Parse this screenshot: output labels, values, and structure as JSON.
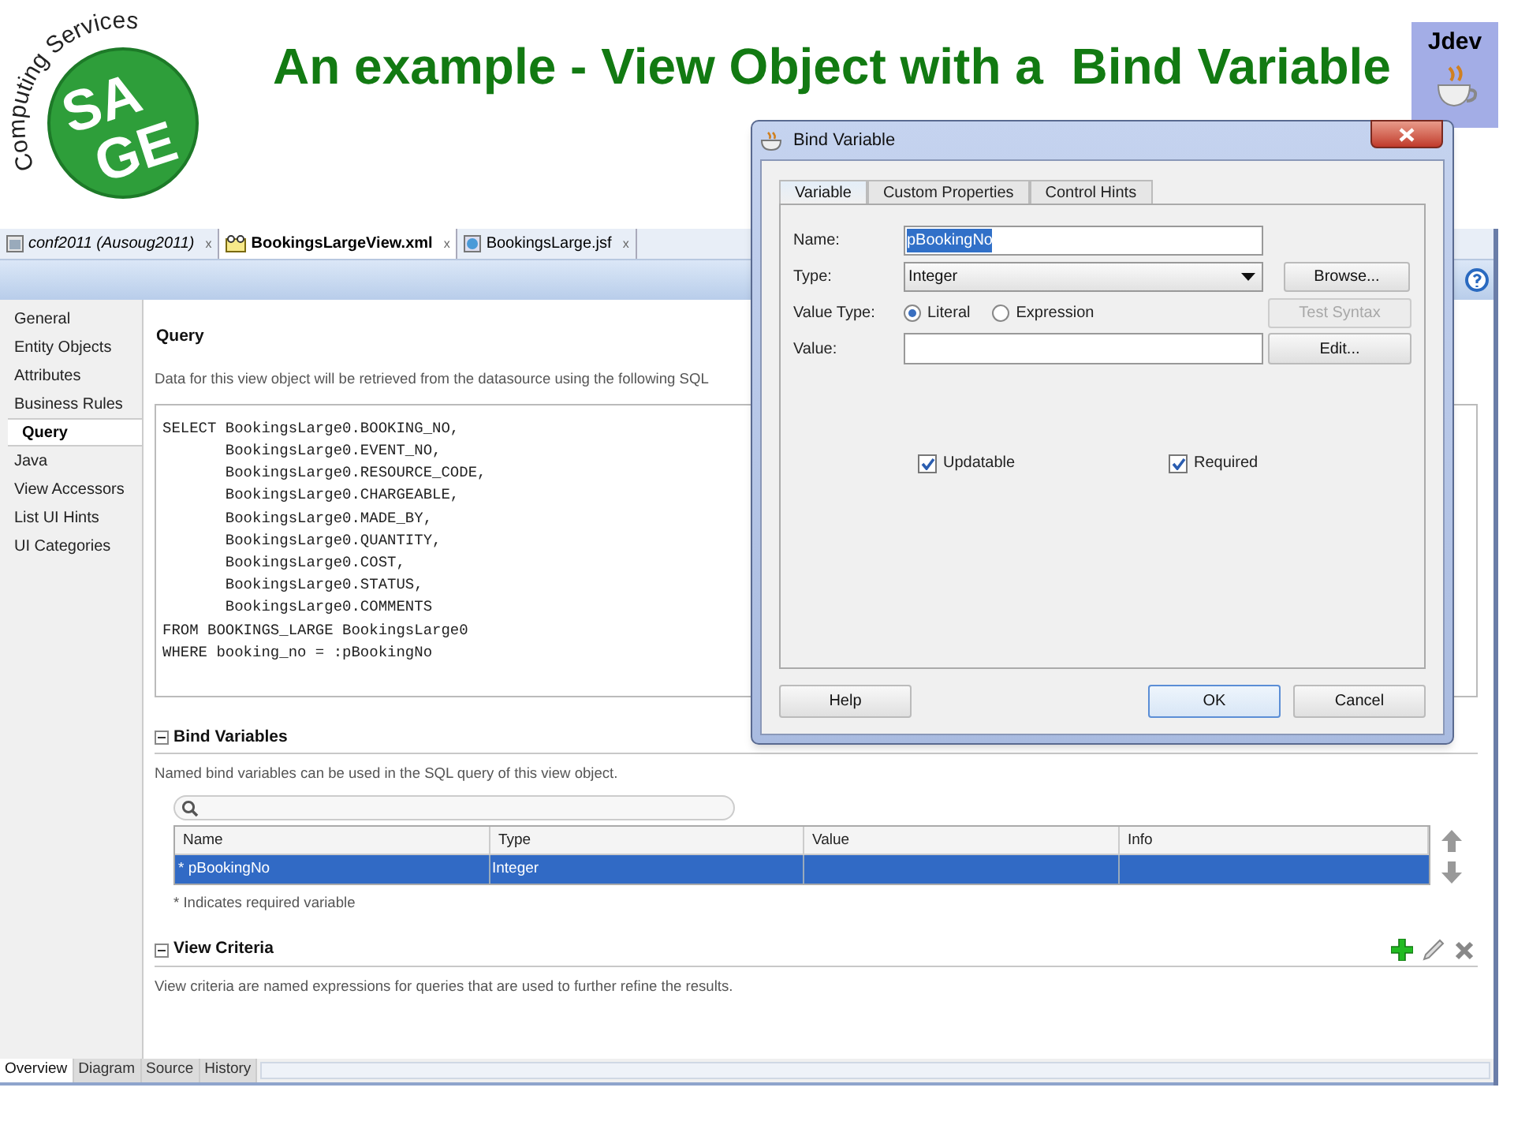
{
  "slide": {
    "title": "An example - View Object with a  Bind Variable",
    "logo": {
      "arc_text": "Computing Services",
      "line_1": "SA",
      "line_2": "GE"
    },
    "badge": "Jdev"
  },
  "editor_tabs": [
    {
      "label": "conf2011 (Ausoug2011)",
      "kind": "project",
      "selected": false,
      "close": "x"
    },
    {
      "label": "BookingsLargeView.xml",
      "kind": "xml",
      "selected": true,
      "close": "x"
    },
    {
      "label": "BookingsLarge.jsf",
      "kind": "jsf",
      "selected": false,
      "close": "x"
    }
  ],
  "sidebar": {
    "items": [
      {
        "label": "General",
        "selected": false
      },
      {
        "label": "Entity Objects",
        "selected": false
      },
      {
        "label": "Attributes",
        "selected": false
      },
      {
        "label": "Business Rules",
        "selected": false
      },
      {
        "label": "Query",
        "selected": true
      },
      {
        "label": "Java",
        "selected": false
      },
      {
        "label": "View Accessors",
        "selected": false
      },
      {
        "label": "List UI Hints",
        "selected": false
      },
      {
        "label": "UI Categories",
        "selected": false
      }
    ]
  },
  "query": {
    "heading": "Query",
    "description": "Data for this view object will be retrieved from the datasource using the following SQL",
    "sql": [
      "SELECT BookingsLarge0.BOOKING_NO,",
      "       BookingsLarge0.EVENT_NO,",
      "       BookingsLarge0.RESOURCE_CODE,",
      "       BookingsLarge0.CHARGEABLE,",
      "       BookingsLarge0.MADE_BY,",
      "       BookingsLarge0.QUANTITY,",
      "       BookingsLarge0.COST,",
      "       BookingsLarge0.STATUS,",
      "       BookingsLarge0.COMMENTS",
      "FROM BOOKINGS_LARGE BookingsLarge0",
      "WHERE booking_no = :pBookingNo"
    ]
  },
  "bind_variables": {
    "heading": "Bind Variables",
    "expanded": true,
    "description": "Named bind variables can be used in the SQL query of this view object.",
    "columns": [
      "Name",
      "Type",
      "Value",
      "Info"
    ],
    "rows": [
      {
        "name": "* pBookingNo",
        "type": "Integer",
        "selected": true
      }
    ],
    "note": "* Indicates required variable"
  },
  "view_criteria": {
    "heading": "View Criteria",
    "expanded": true,
    "description": "View criteria are named expressions for queries that are used to further refine the results."
  },
  "bottom_tabs": [
    {
      "label": "Overview",
      "selected": true
    },
    {
      "label": "Diagram",
      "selected": false
    },
    {
      "label": "Source",
      "selected": false
    },
    {
      "label": "History",
      "selected": false
    }
  ],
  "dialog": {
    "title": "Bind Variable",
    "tabs": [
      {
        "label": "Variable",
        "selected": true
      },
      {
        "label": "Custom Properties",
        "selected": false
      },
      {
        "label": "Control Hints",
        "selected": false
      }
    ],
    "name_field": {
      "label": "Name:",
      "value": "pBookingNo",
      "text_selected": true
    },
    "type_field": {
      "label": "Type:",
      "value": "Integer"
    },
    "browse_button": "Browse...",
    "value_type": {
      "label": "Value Type:",
      "options": [
        {
          "label": "Literal",
          "selected": true
        },
        {
          "label": "Expression",
          "selected": false
        }
      ]
    },
    "test_syntax_button": {
      "label": "Test Syntax",
      "disabled": true
    },
    "value_field": {
      "label": "Value:"
    },
    "edit_button": "Edit...",
    "checkboxes": [
      {
        "label": "Updatable",
        "checked": true
      },
      {
        "label": "Required",
        "checked": true
      }
    ],
    "buttons": [
      {
        "label": "Help",
        "default": false
      },
      {
        "label": "OK",
        "default": true
      },
      {
        "label": "Cancel",
        "default": false
      }
    ]
  }
}
